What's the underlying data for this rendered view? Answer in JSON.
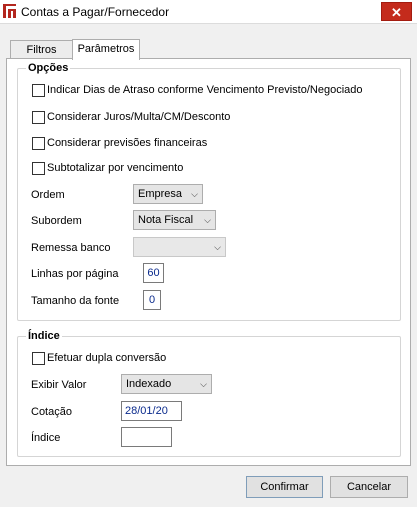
{
  "window": {
    "title": "Contas a Pagar/Fornecedor",
    "close_glyph": "✕"
  },
  "tabs": [
    {
      "label": "Filtros"
    },
    {
      "label": "Parâmetros"
    }
  ],
  "opcoes": {
    "title": "Opções",
    "checkboxes": [
      {
        "label": "Indicar Dias de Atraso conforme Vencimento Previsto/Negociado",
        "checked": false
      },
      {
        "label": "Considerar Juros/Multa/CM/Desconto",
        "checked": false
      },
      {
        "label": "Considerar previsões financeiras",
        "checked": false
      },
      {
        "label": "Subtotalizar por vencimento",
        "checked": false
      }
    ],
    "ordem": {
      "label": "Ordem",
      "value": "Empresa"
    },
    "subordem": {
      "label": "Subordem",
      "value": "Nota Fiscal"
    },
    "remessa": {
      "label": "Remessa banco",
      "value": ""
    },
    "linhas": {
      "label": "Linhas por página",
      "value": "60"
    },
    "fonte": {
      "label": "Tamanho da fonte",
      "value": "0"
    }
  },
  "indice": {
    "title": "Índice",
    "dupla": {
      "label": "Efetuar dupla conversão",
      "checked": false
    },
    "exibir": {
      "label": "Exibir Valor",
      "value": "Indexado"
    },
    "cotacao": {
      "label": "Cotação",
      "value": "28/01/20"
    },
    "indice_field": {
      "label": "Índice",
      "value": ""
    }
  },
  "buttons": {
    "confirm": "Confirmar",
    "cancel": "Cancelar"
  },
  "colors": {
    "close": "#c42b1c",
    "app_icon": "#b3261e",
    "field_text": "#0a2a8c"
  },
  "icons": {
    "app": "app-logo-icon",
    "dropdown": "chevron-down-icon"
  }
}
